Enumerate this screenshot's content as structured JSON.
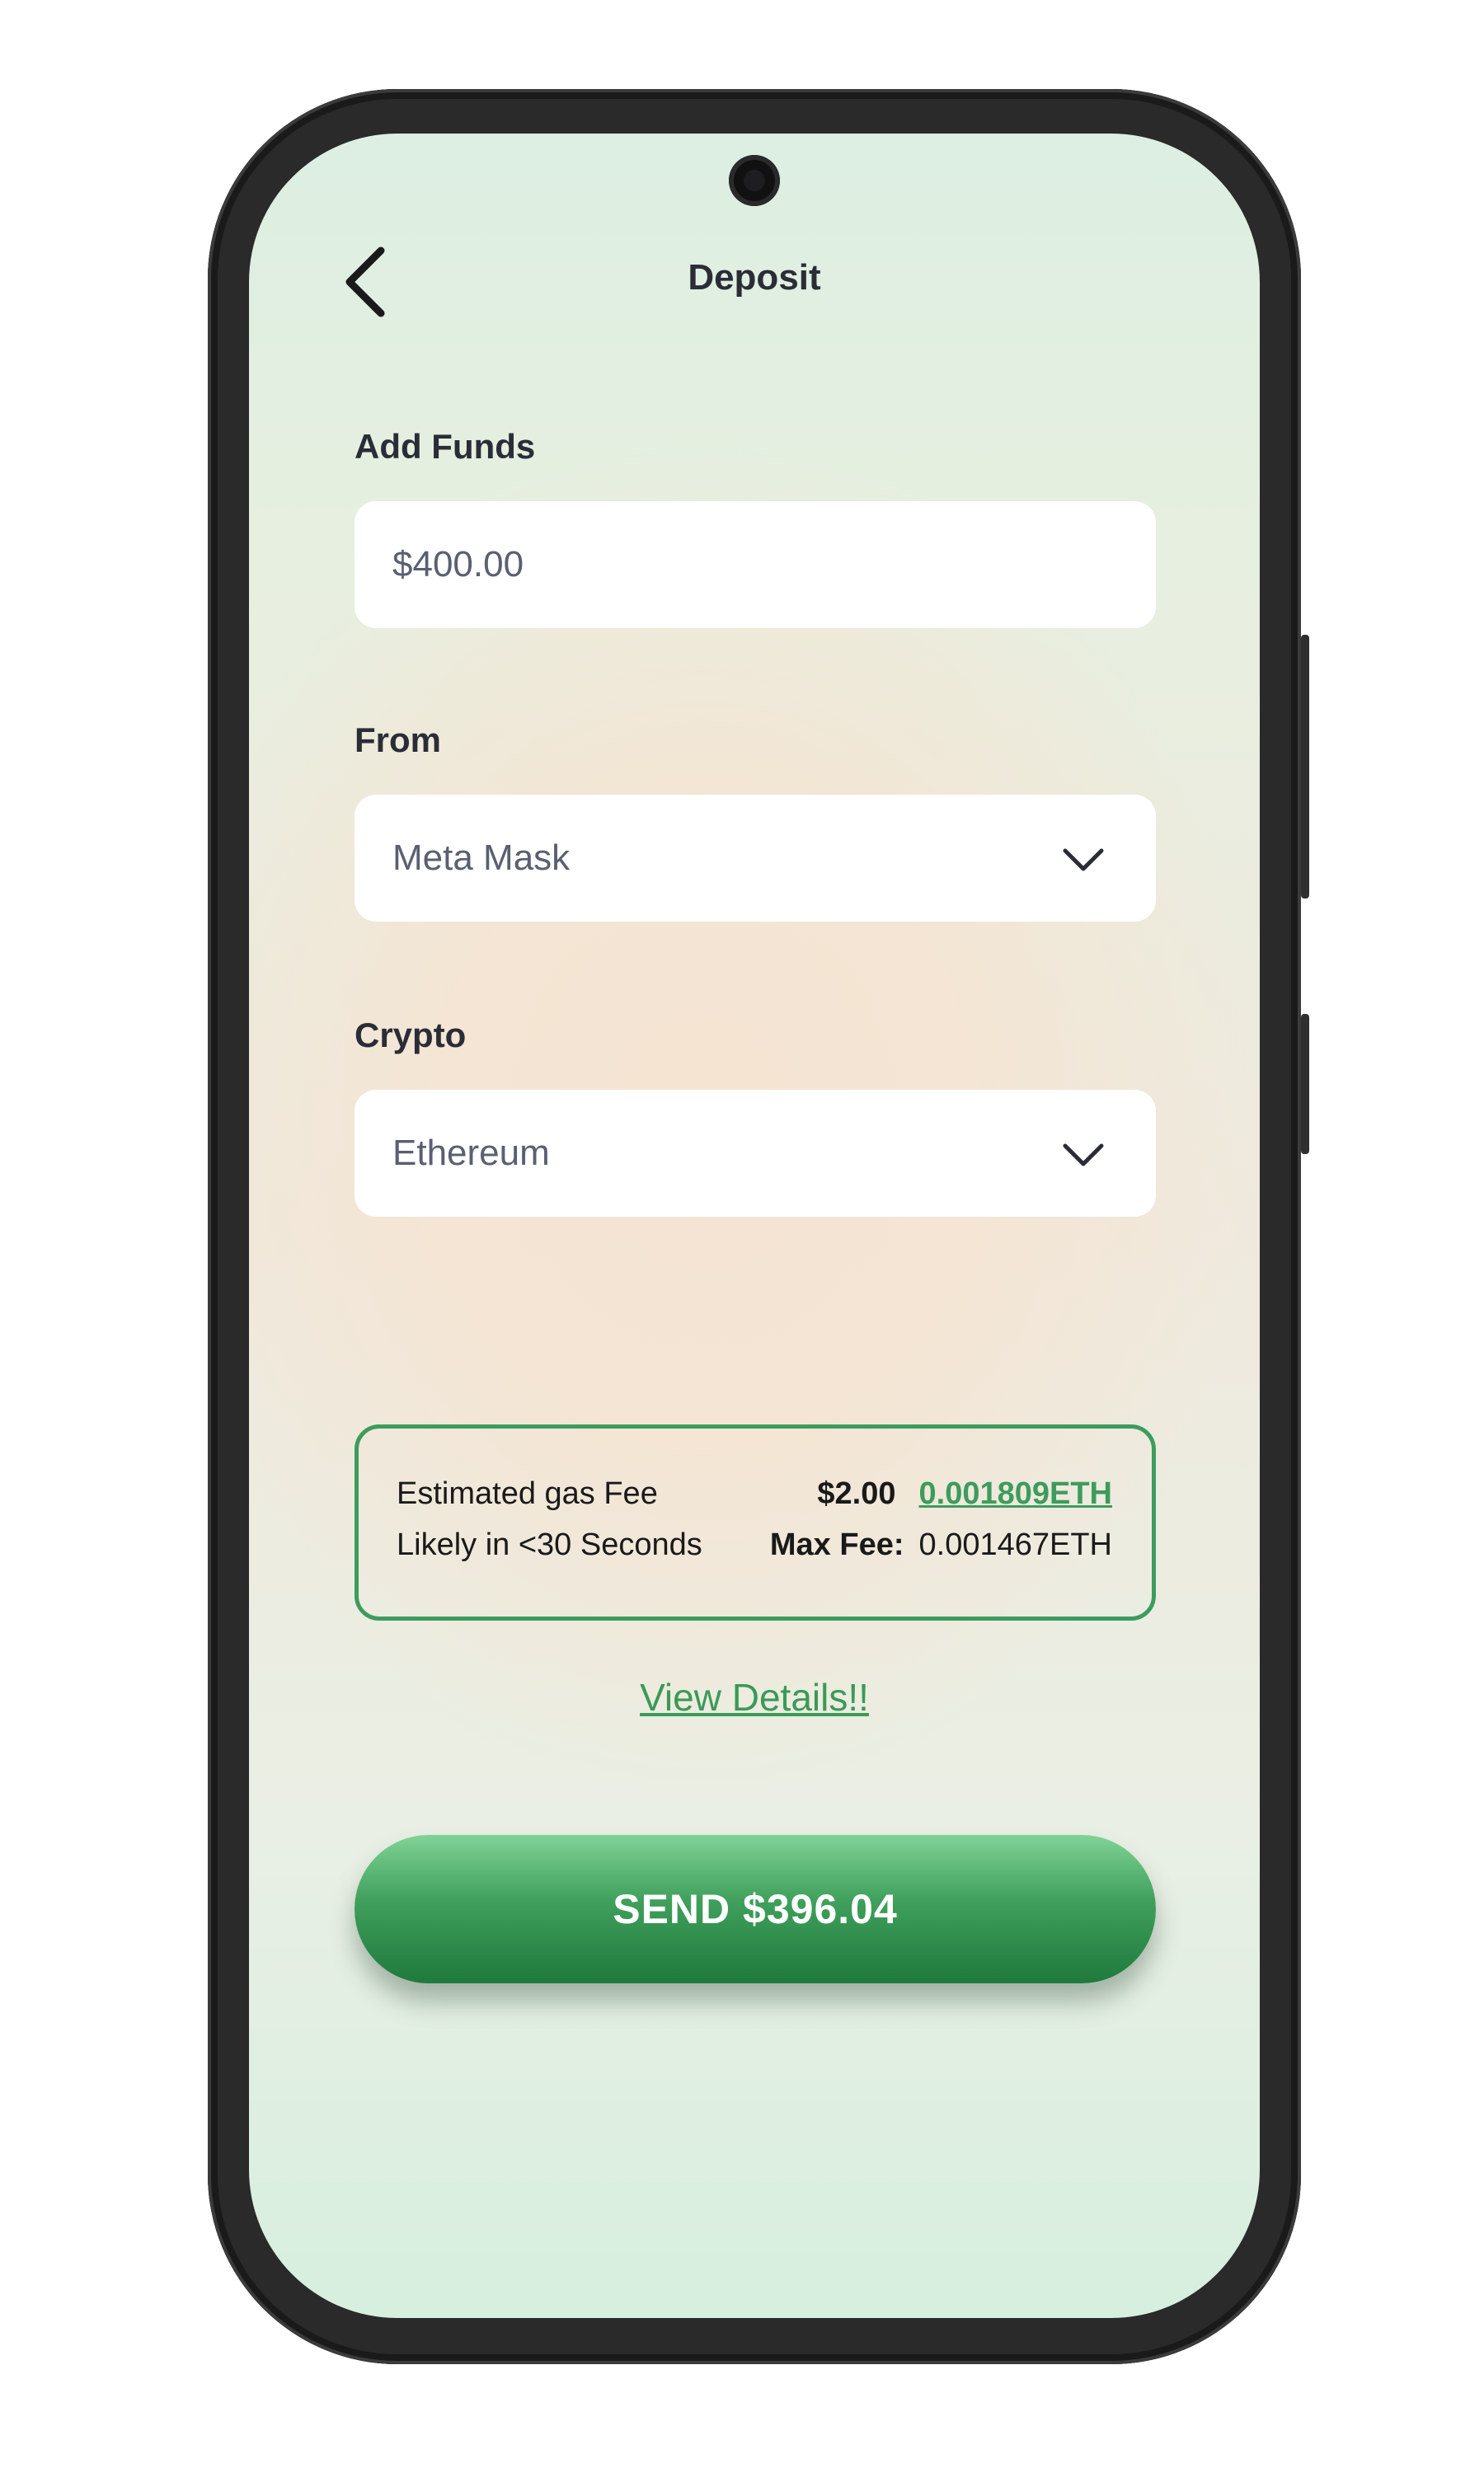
{
  "header": {
    "title": "Deposit",
    "back_icon": "chevron-left-icon"
  },
  "form": {
    "add_funds_label": "Add Funds",
    "amount_value": "$400.00",
    "from_label": "From",
    "from_value": "Meta Mask",
    "crypto_label": "Crypto",
    "crypto_value": "Ethereum",
    "dropdown_icon": "chevron-down-icon"
  },
  "fee": {
    "estimated_label": "Estimated gas Fee",
    "time_label": "Likely in <30 Seconds",
    "usd_fee": "$2.00",
    "eth_fee": "0.001809ETH",
    "max_fee_label": "Max Fee:",
    "max_fee_value": "0.001467ETH"
  },
  "actions": {
    "view_details": "View Details!!",
    "send_label": "SEND $396.04"
  },
  "colors": {
    "accent_green": "#3d9c5d",
    "text_dark": "#2b2d36"
  }
}
